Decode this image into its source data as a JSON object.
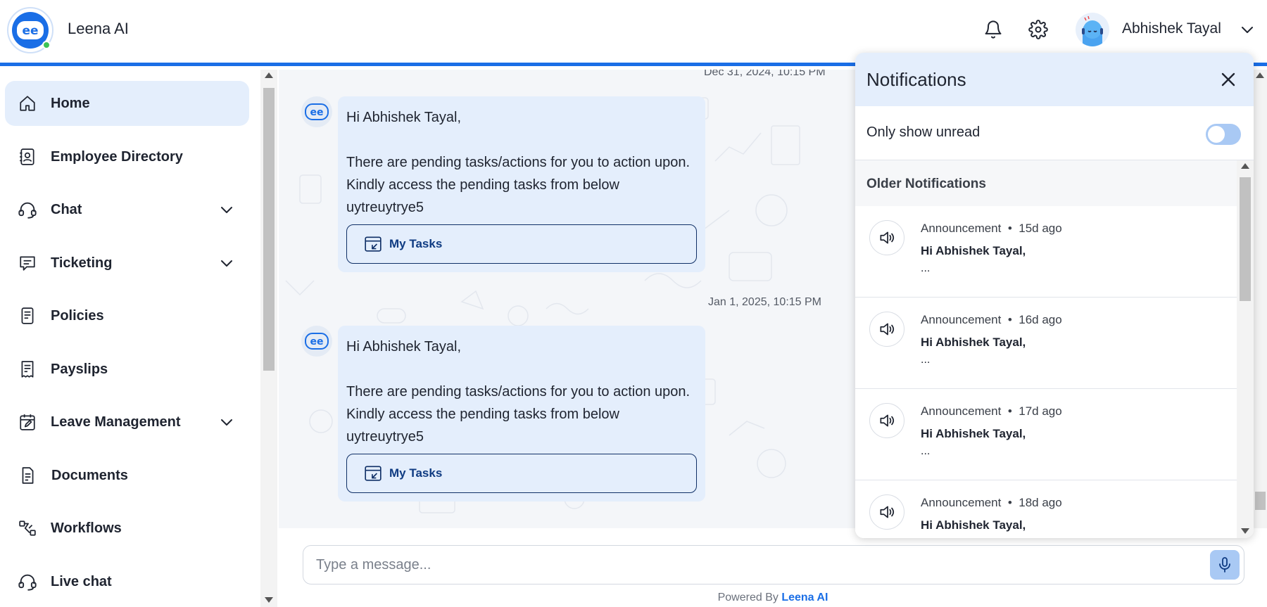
{
  "header": {
    "app_title": "Leena AI",
    "user_name": "Abhishek Tayal"
  },
  "sidebar": {
    "items": [
      {
        "label": "Home",
        "icon": "home-icon",
        "active": true
      },
      {
        "label": "Employee Directory",
        "icon": "contact-book-icon"
      },
      {
        "label": "Chat",
        "icon": "headset-icon",
        "expandable": true
      },
      {
        "label": "Ticketing",
        "icon": "message-lines-icon",
        "expandable": true
      },
      {
        "label": "Policies",
        "icon": "document-list-icon"
      },
      {
        "label": "Payslips",
        "icon": "receipt-icon"
      },
      {
        "label": "Leave Management",
        "icon": "calendar-edit-icon",
        "expandable": true
      },
      {
        "label": "Documents",
        "icon": "document-icon"
      },
      {
        "label": "Workflows",
        "icon": "workflow-icon"
      },
      {
        "label": "Live chat",
        "icon": "headset-icon"
      }
    ]
  },
  "chat": {
    "messages": [
      {
        "date": "Dec 31, 2024, 10:15 PM",
        "text": "Hi Abhishek Tayal,\n\nThere are pending tasks/actions for you to action upon. Kindly access the pending tasks from below\nuytreuytrye5",
        "button_label": "My Tasks"
      },
      {
        "date": "Jan 1, 2025, 10:15 PM",
        "text": "Hi Abhishek Tayal,\n\nThere are pending tasks/actions for you to action upon. Kindly access the pending tasks from below\nuytreuytrye5",
        "button_label": "My Tasks"
      }
    ]
  },
  "composer": {
    "placeholder": "Type a message...",
    "powered_prefix": "Powered By",
    "powered_brand": "Leena AI"
  },
  "notifications": {
    "title": "Notifications",
    "unread_label": "Only show unread",
    "unread_on": false,
    "section_label": "Older Notifications",
    "items": [
      {
        "type": "Announcement",
        "age": "15d ago",
        "line": "Hi Abhishek Tayal,",
        "more": "..."
      },
      {
        "type": "Announcement",
        "age": "16d ago",
        "line": "Hi Abhishek Tayal,",
        "more": "..."
      },
      {
        "type": "Announcement",
        "age": "17d ago",
        "line": "Hi Abhishek Tayal,",
        "more": "..."
      },
      {
        "type": "Announcement",
        "age": "18d ago",
        "line": "Hi Abhishek Tayal,",
        "more": ""
      }
    ]
  },
  "colors": {
    "accent": "#1a6ee6",
    "bubble": "#e4eefc",
    "active_nav": "#e4eefc",
    "online": "#3cc356"
  }
}
